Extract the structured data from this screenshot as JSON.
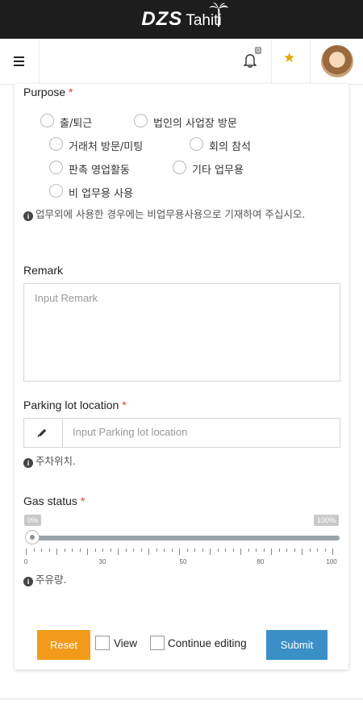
{
  "app": {
    "logo": "DZS",
    "name": "Tahiti"
  },
  "header": {
    "menu_icon": "hamburger-icon",
    "notification_count": "0",
    "bell_icon": "bell-icon",
    "favorite_icon": "star-icon",
    "avatar_icon": "user-avatar"
  },
  "purpose": {
    "label": "Purpose",
    "required": "*",
    "options": [
      "출/퇴근",
      "법인의 사업장 방문",
      "거래처 방문/미팅",
      "회의 참석",
      "판촉 영업활동",
      "기타 업무용",
      "비 업무용 사용"
    ],
    "info": "업무외에 사용한 경우에는 비업무용사용으로 기재하여 주십시오."
  },
  "remark": {
    "label": "Remark",
    "placeholder": "Input Remark"
  },
  "parking": {
    "label": "Parking lot location",
    "required": "*",
    "icon": "pencil-icon",
    "placeholder": "Input Parking lot location",
    "info": "주차위치."
  },
  "gas": {
    "label": "Gas status",
    "required": "*",
    "min_label": "0%",
    "max_label": "100%",
    "value": 0,
    "tick_labels": [
      "0",
      "30",
      "50",
      "80",
      "100"
    ],
    "info": "주유량."
  },
  "actions": {
    "reset": "Reset",
    "view": "View",
    "continue_editing": "Continue editing",
    "submit": "Submit"
  },
  "colors": {
    "topbar": "#1d1d1d",
    "reset": "#f29b1a",
    "submit": "#3a8fc7",
    "required": "#e23b3b",
    "star": "#e0a800"
  }
}
